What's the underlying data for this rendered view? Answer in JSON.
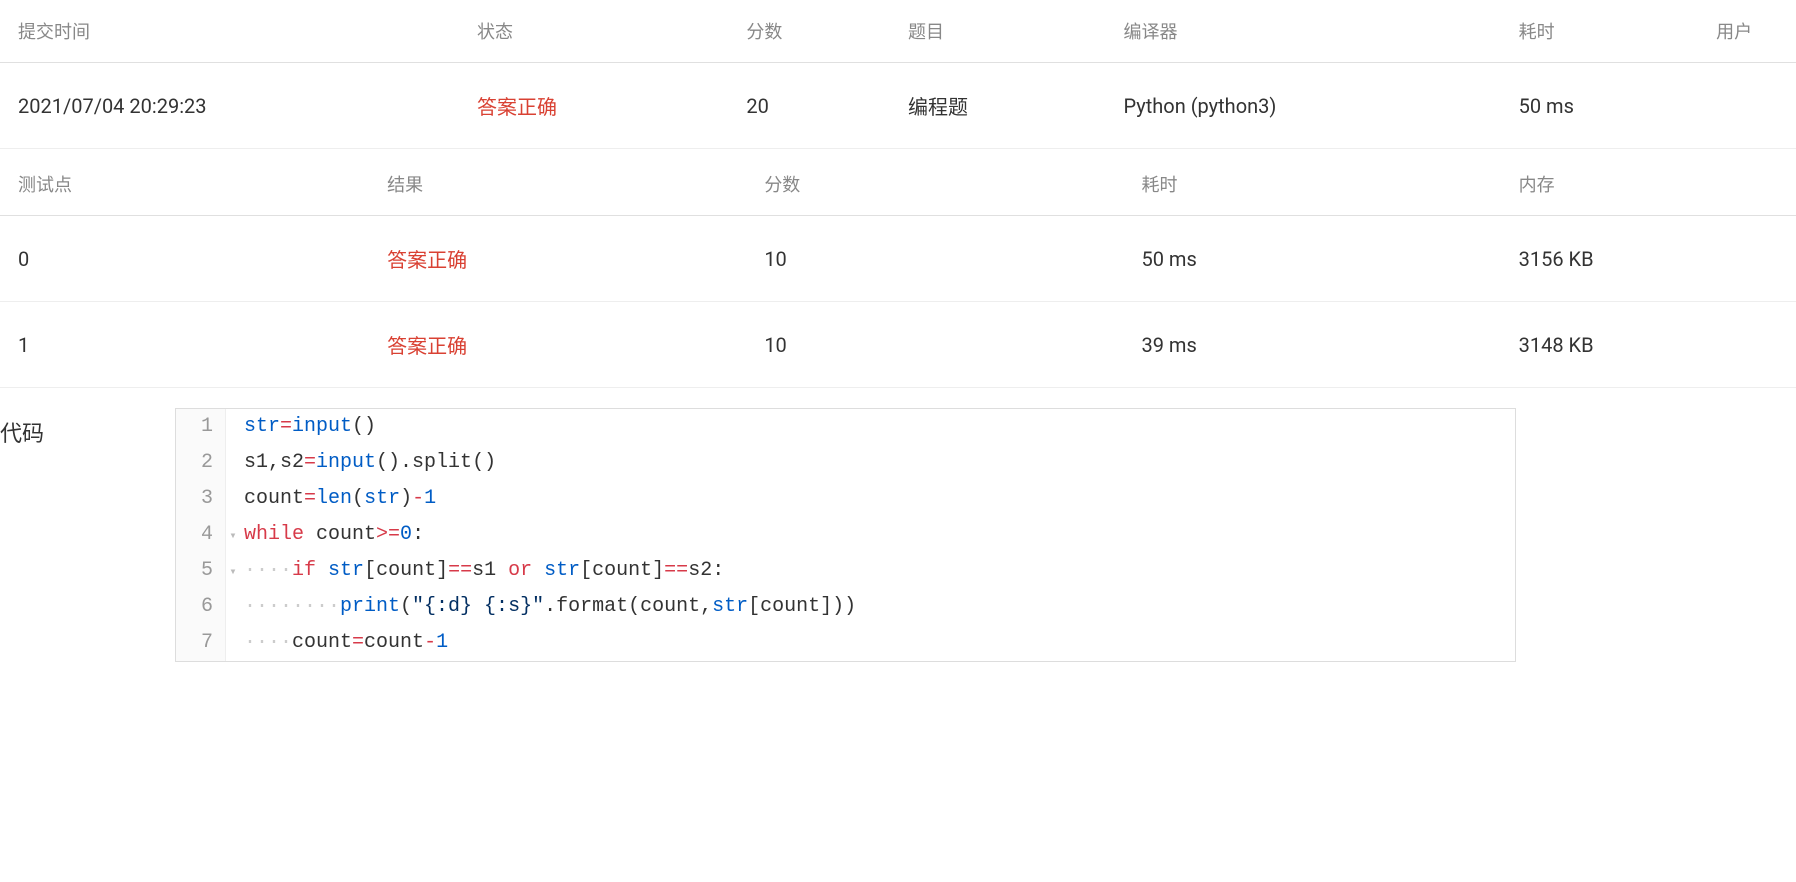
{
  "submission_table": {
    "headers": {
      "time": "提交时间",
      "status": "状态",
      "score": "分数",
      "problem": "题目",
      "compiler": "编译器",
      "time_cost": "耗时",
      "user": "用户"
    },
    "row": {
      "time": "2021/07/04 20:29:23",
      "status": "答案正确",
      "score": "20",
      "problem": "编程题",
      "compiler": "Python (python3)",
      "time_cost": "50 ms",
      "user": ""
    }
  },
  "testpoint_table": {
    "headers": {
      "tp": "测试点",
      "result": "结果",
      "score": "分数",
      "time_cost": "耗时",
      "memory": "内存"
    },
    "rows": [
      {
        "tp": "0",
        "result": "答案正确",
        "score": "10",
        "time_cost": "50 ms",
        "memory": "3156 KB"
      },
      {
        "tp": "1",
        "result": "答案正确",
        "score": "10",
        "time_cost": "39 ms",
        "memory": "3148 KB"
      }
    ]
  },
  "code_label": "代码",
  "code_lines": [
    {
      "n": "1",
      "fold": "",
      "tokens": [
        [
          "blue",
          "str"
        ],
        [
          "op",
          "="
        ],
        [
          "blue",
          "input"
        ],
        [
          "plain",
          "()"
        ]
      ]
    },
    {
      "n": "2",
      "fold": "",
      "tokens": [
        [
          "plain",
          "s1,s2"
        ],
        [
          "op",
          "="
        ],
        [
          "blue",
          "input"
        ],
        [
          "plain",
          "().split()"
        ]
      ]
    },
    {
      "n": "3",
      "fold": "",
      "tokens": [
        [
          "plain",
          "count"
        ],
        [
          "op",
          "="
        ],
        [
          "blue",
          "len"
        ],
        [
          "plain",
          "("
        ],
        [
          "blue",
          "str"
        ],
        [
          "plain",
          ")"
        ],
        [
          "op",
          "-"
        ],
        [
          "num",
          "1"
        ]
      ]
    },
    {
      "n": "4",
      "fold": "▾",
      "tokens": [
        [
          "kw",
          "while"
        ],
        [
          "plain",
          " count"
        ],
        [
          "op",
          ">="
        ],
        [
          "num",
          "0"
        ],
        [
          "plain",
          ":"
        ]
      ]
    },
    {
      "n": "5",
      "fold": "▾",
      "tokens": [
        [
          "dots",
          "····"
        ],
        [
          "kw",
          "if"
        ],
        [
          "plain",
          " "
        ],
        [
          "blue",
          "str"
        ],
        [
          "plain",
          "[count]"
        ],
        [
          "op",
          "=="
        ],
        [
          "plain",
          "s1 "
        ],
        [
          "kw",
          "or"
        ],
        [
          "plain",
          " "
        ],
        [
          "blue",
          "str"
        ],
        [
          "plain",
          "[count]"
        ],
        [
          "op",
          "=="
        ],
        [
          "plain",
          "s2:"
        ]
      ]
    },
    {
      "n": "6",
      "fold": "",
      "tokens": [
        [
          "dots",
          "········"
        ],
        [
          "blue",
          "print"
        ],
        [
          "plain",
          "("
        ],
        [
          "str",
          "\"{:d} {:s}\""
        ],
        [
          "plain",
          ".format(count,"
        ],
        [
          "blue",
          "str"
        ],
        [
          "plain",
          "[count]))"
        ]
      ]
    },
    {
      "n": "7",
      "fold": "",
      "tokens": [
        [
          "dots",
          "····"
        ],
        [
          "plain",
          "count"
        ],
        [
          "op",
          "="
        ],
        [
          "plain",
          "count"
        ],
        [
          "op",
          "-"
        ],
        [
          "num",
          "1"
        ]
      ]
    }
  ]
}
